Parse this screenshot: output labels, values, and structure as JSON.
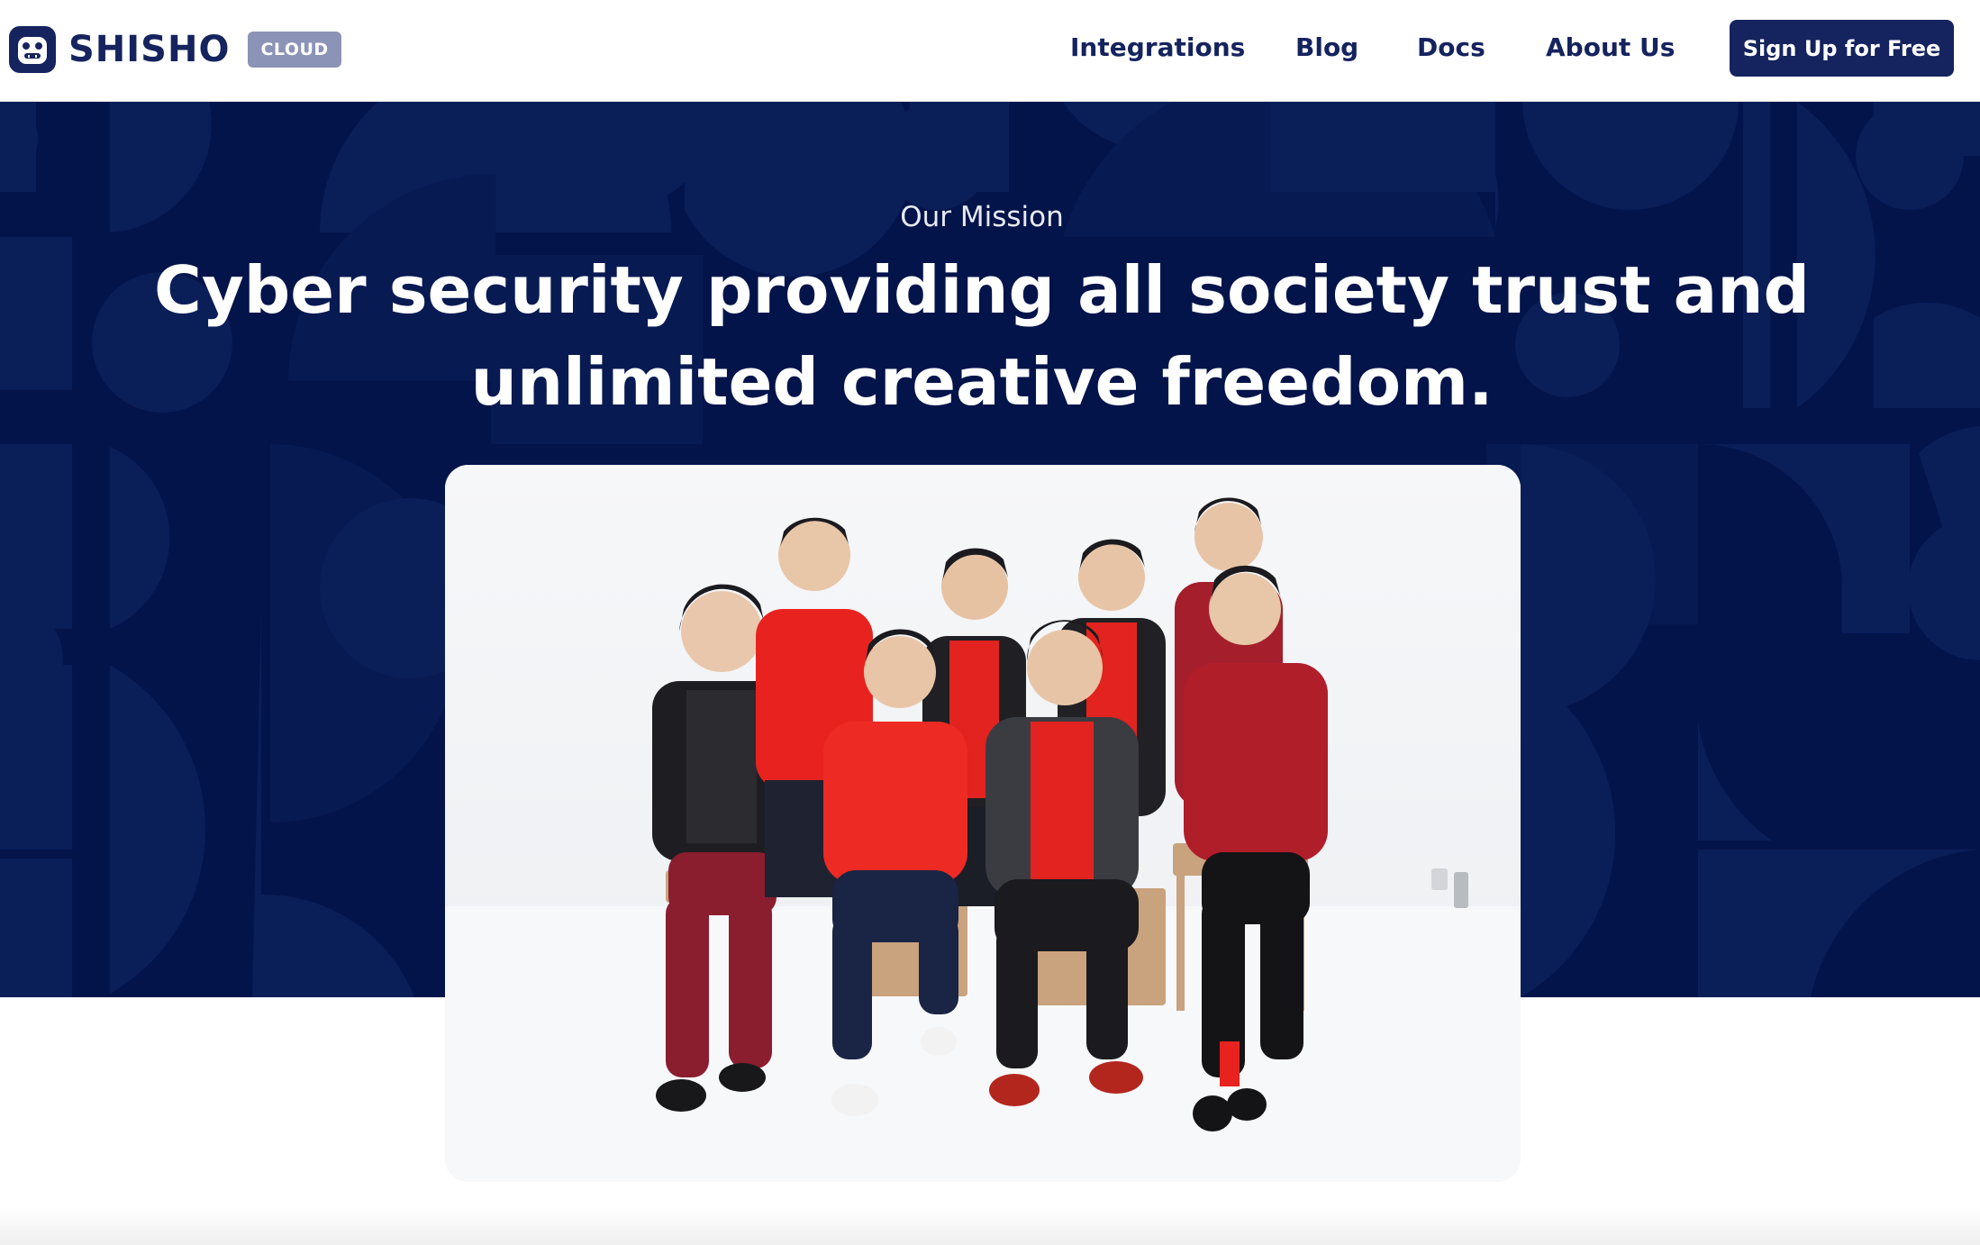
{
  "header": {
    "brand": "SHISHO",
    "badge": "CLOUD",
    "nav": {
      "integrations": "Integrations",
      "blog": "Blog",
      "docs": "Docs",
      "about": "About Us"
    },
    "cta": "Sign Up for Free"
  },
  "hero": {
    "eyebrow": "Our Mission",
    "headline_line1": "Cyber security providing all society trust and",
    "headline_line2": "unlimited creative freedom."
  },
  "colors": {
    "brand_navy": "#15235e",
    "hero_background": "#03144a",
    "badge": "#8b93b6"
  }
}
